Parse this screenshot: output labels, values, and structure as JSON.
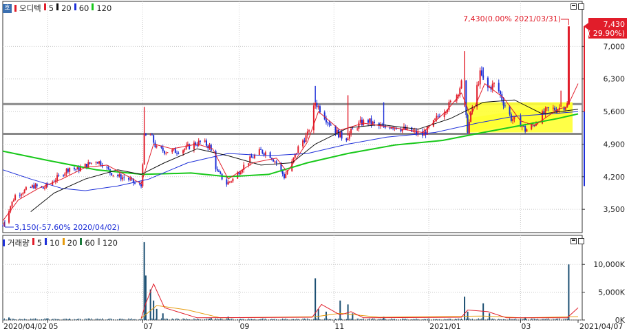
{
  "price_legend": {
    "badge": "호",
    "title": "오디텍",
    "ma": [
      {
        "label": "5",
        "color": "#e11d2a"
      },
      {
        "label": "20",
        "color": "#111111"
      },
      {
        "label": "60",
        "color": "#1d2fd8"
      },
      {
        "label": "120",
        "color": "#18c81a"
      }
    ]
  },
  "volume_legend": {
    "title": "거래량",
    "ma": [
      {
        "label": "5",
        "color": "#e11d2a"
      },
      {
        "label": "10",
        "color": "#1d2fd8"
      },
      {
        "label": "20",
        "color": "#e69b0c"
      },
      {
        "label": "60",
        "color": "#1a7a3a"
      },
      {
        "label": "120",
        "color": "#999999"
      }
    ]
  },
  "annotations": {
    "high": "7,430(0.00% 2021/03/31)",
    "low": "3,150(-57.60% 2020/04/02)",
    "last_price": "7,430",
    "last_change": "( 29.90%)"
  },
  "colors": {
    "up": "#e11d2a",
    "down": "#1d2fd8",
    "ma5": "#e11d2a",
    "ma20": "#111111",
    "ma60": "#1d2fd8",
    "ma120": "#18c81a",
    "volume_bar": "#1b4f72",
    "hline": "#888888",
    "box": "#ffff33",
    "grid": "#c8c8c8"
  },
  "chart_data": [
    {
      "type": "candlestick",
      "title": "오디텍",
      "ylim": [
        3000,
        7700
      ],
      "yticks": [
        3500,
        4200,
        4900,
        5600,
        6300,
        7000
      ],
      "ytick_labels": [
        "3,500",
        "4,200",
        "4,900",
        "5,600",
        "6,300",
        "7,000"
      ],
      "x_labels": [
        "2020/04/02",
        "05",
        "07",
        "09",
        "11",
        "2021/01",
        "03",
        "2021/04/07"
      ],
      "horizontal_lines": [
        5760,
        5120
      ],
      "highlight_box": {
        "from": "2021/01/25",
        "to": "2021/04/07",
        "y_from": 5150,
        "y_to": 5800
      },
      "price_path": [
        [
          "2020/04/02",
          3150
        ],
        [
          "2020/04/06",
          3500
        ],
        [
          "2020/04/10",
          3800
        ],
        [
          "2020/04/16",
          3900
        ],
        [
          "2020/04/22",
          4000
        ],
        [
          "2020/04/28",
          3950
        ],
        [
          "2020/05/04",
          4100
        ],
        [
          "2020/05/10",
          4250
        ],
        [
          "2020/05/15",
          4400
        ],
        [
          "2020/05/20",
          4350
        ],
        [
          "2020/05/26",
          4450
        ],
        [
          "2020/06/01",
          4550
        ],
        [
          "2020/06/05",
          4480
        ],
        [
          "2020/06/10",
          4300
        ],
        [
          "2020/06/16",
          4200
        ],
        [
          "2020/06/22",
          4150
        ],
        [
          "2020/06/26",
          4050
        ],
        [
          "2020/06/30",
          4000
        ],
        [
          "2020/07/02",
          5050
        ],
        [
          "2020/07/06",
          5100
        ],
        [
          "2020/07/10",
          4800
        ],
        [
          "2020/07/16",
          4750
        ],
        [
          "2020/07/22",
          4750
        ],
        [
          "2020/07/28",
          4800
        ],
        [
          "2020/08/03",
          4900
        ],
        [
          "2020/08/08",
          4950
        ],
        [
          "2020/08/13",
          4850
        ],
        [
          "2020/08/18",
          4300
        ],
        [
          "2020/08/24",
          4050
        ],
        [
          "2020/08/28",
          4150
        ],
        [
          "2020/09/03",
          4400
        ],
        [
          "2020/09/09",
          4600
        ],
        [
          "2020/09/15",
          4750
        ],
        [
          "2020/09/20",
          4700
        ],
        [
          "2020/09/25",
          4500
        ],
        [
          "2020/09/30",
          4200
        ],
        [
          "2020/10/05",
          4500
        ],
        [
          "2020/10/10",
          4900
        ],
        [
          "2020/10/15",
          5100
        ],
        [
          "2020/10/20",
          5800
        ],
        [
          "2020/10/24",
          5600
        ],
        [
          "2020/10/28",
          5400
        ],
        [
          "2020/11/03",
          5150
        ],
        [
          "2020/11/08",
          5000
        ],
        [
          "2020/11/13",
          5200
        ],
        [
          "2020/11/18",
          5350
        ],
        [
          "2020/11/23",
          5400
        ],
        [
          "2020/11/28",
          5300
        ],
        [
          "2020/12/03",
          5250
        ],
        [
          "2020/12/08",
          5300
        ],
        [
          "2020/12/13",
          5250
        ],
        [
          "2020/12/18",
          5200
        ],
        [
          "2020/12/23",
          5150
        ],
        [
          "2020/12/28",
          5100
        ],
        [
          "2021/01/03",
          5300
        ],
        [
          "2021/01/08",
          5550
        ],
        [
          "2021/01/13",
          5700
        ],
        [
          "2021/01/18",
          5900
        ],
        [
          "2021/01/22",
          6200
        ],
        [
          "2021/01/26",
          5200
        ],
        [
          "2021/01/29",
          5700
        ],
        [
          "2021/02/03",
          6400
        ],
        [
          "2021/02/08",
          6100
        ],
        [
          "2021/02/13",
          6200
        ],
        [
          "2021/02/18",
          5800
        ],
        [
          "2021/02/23",
          5450
        ],
        [
          "2021/02/28",
          5400
        ],
        [
          "2021/03/04",
          5200
        ],
        [
          "2021/03/09",
          5300
        ],
        [
          "2021/03/14",
          5500
        ],
        [
          "2021/03/19",
          5650
        ],
        [
          "2021/03/24",
          5650
        ],
        [
          "2021/03/31",
          5750
        ],
        [
          "2021/04/01",
          7430
        ],
        [
          "2021/04/07",
          7430
        ]
      ],
      "ma5": [
        [
          "2020/04/02",
          3250
        ],
        [
          "2020/04/12",
          3700
        ],
        [
          "2020/04/25",
          3950
        ],
        [
          "2020/05/10",
          4150
        ],
        [
          "2020/05/25",
          4400
        ],
        [
          "2020/06/08",
          4450
        ],
        [
          "2020/06/22",
          4200
        ],
        [
          "2020/06/30",
          4050
        ],
        [
          "2020/07/08",
          4900
        ],
        [
          "2020/07/20",
          4800
        ],
        [
          "2020/08/05",
          4900
        ],
        [
          "2020/08/15",
          4800
        ],
        [
          "2020/08/25",
          4150
        ],
        [
          "2020/09/10",
          4500
        ],
        [
          "2020/09/25",
          4600
        ],
        [
          "2020/10/02",
          4300
        ],
        [
          "2020/10/15",
          4950
        ],
        [
          "2020/10/22",
          5600
        ],
        [
          "2020/11/05",
          5200
        ],
        [
          "2020/11/20",
          5350
        ],
        [
          "2020/12/10",
          5250
        ],
        [
          "2020/12/28",
          5150
        ],
        [
          "2021/01/12",
          5600
        ],
        [
          "2021/01/22",
          6000
        ],
        [
          "2021/01/28",
          5500
        ],
        [
          "2021/02/06",
          6200
        ],
        [
          "2021/02/18",
          5900
        ],
        [
          "2021/03/01",
          5400
        ],
        [
          "2021/03/10",
          5300
        ],
        [
          "2021/03/25",
          5650
        ],
        [
          "2021/03/31",
          5700
        ],
        [
          "2021/04/07",
          6200
        ]
      ],
      "ma20": [
        [
          "2020/04/20",
          3450
        ],
        [
          "2020/05/05",
          3850
        ],
        [
          "2020/05/25",
          4150
        ],
        [
          "2020/06/15",
          4350
        ],
        [
          "2020/06/30",
          4250
        ],
        [
          "2020/07/15",
          4500
        ],
        [
          "2020/08/05",
          4800
        ],
        [
          "2020/08/25",
          4650
        ],
        [
          "2020/09/15",
          4450
        ],
        [
          "2020/10/05",
          4500
        ],
        [
          "2020/10/20",
          4900
        ],
        [
          "2020/11/10",
          5250
        ],
        [
          "2020/12/01",
          5320
        ],
        [
          "2020/12/25",
          5220
        ],
        [
          "2021/01/15",
          5450
        ],
        [
          "2021/02/05",
          5800
        ],
        [
          "2021/02/25",
          5850
        ],
        [
          "2021/03/15",
          5550
        ],
        [
          "2021/04/07",
          5650
        ]
      ],
      "ma60": [
        [
          "2020/04/02",
          4350
        ],
        [
          "2020/04/20",
          4150
        ],
        [
          "2020/05/10",
          3950
        ],
        [
          "2020/05/25",
          3900
        ],
        [
          "2020/06/15",
          4000
        ],
        [
          "2020/07/05",
          4150
        ],
        [
          "2020/07/30",
          4500
        ],
        [
          "2020/08/25",
          4700
        ],
        [
          "2020/09/20",
          4650
        ],
        [
          "2020/10/15",
          4700
        ],
        [
          "2020/11/10",
          4900
        ],
        [
          "2020/12/05",
          5050
        ],
        [
          "2021/01/05",
          5150
        ],
        [
          "2021/02/01",
          5350
        ],
        [
          "2021/02/25",
          5500
        ],
        [
          "2021/03/20",
          5550
        ],
        [
          "2021/04/07",
          5600
        ]
      ],
      "ma120": [
        [
          "2020/04/02",
          4750
        ],
        [
          "2020/05/01",
          4550
        ],
        [
          "2020/06/01",
          4350
        ],
        [
          "2020/07/01",
          4250
        ],
        [
          "2020/08/01",
          4280
        ],
        [
          "2020/08/25",
          4200
        ],
        [
          "2020/09/20",
          4250
        ],
        [
          "2020/10/15",
          4500
        ],
        [
          "2020/11/10",
          4700
        ],
        [
          "2020/12/10",
          4880
        ],
        [
          "2021/01/10",
          4980
        ],
        [
          "2021/02/05",
          5150
        ],
        [
          "2021/03/01",
          5300
        ],
        [
          "2021/03/25",
          5450
        ],
        [
          "2021/04/07",
          5550
        ]
      ],
      "spikes": [
        [
          "2020/07/02",
          5700
        ],
        [
          "2020/10/20",
          6150
        ],
        [
          "2020/11/10",
          5950
        ],
        [
          "2020/12/03",
          5800
        ],
        [
          "2021/01/24",
          6900
        ],
        [
          "2021/02/05",
          6550
        ],
        [
          "2021/03/27",
          6050
        ]
      ]
    },
    {
      "type": "bar",
      "title": "거래량",
      "ylim": [
        0,
        13000
      ],
      "yticks": [
        0,
        5000,
        10000
      ],
      "ytick_labels": [
        "0K",
        "5,000K",
        "10,000K"
      ],
      "bars": [
        [
          "2020/04/06",
          450
        ],
        [
          "2020/05/01",
          300
        ],
        [
          "2020/05/15",
          200
        ],
        [
          "2020/07/02",
          14000
        ],
        [
          "2020/07/03",
          8000
        ],
        [
          "2020/07/06",
          5500
        ],
        [
          "2020/07/08",
          3500
        ],
        [
          "2020/07/10",
          2000
        ],
        [
          "2020/07/14",
          1200
        ],
        [
          "2020/08/14",
          400
        ],
        [
          "2020/08/25",
          600
        ],
        [
          "2020/10/20",
          7500
        ],
        [
          "2020/10/22",
          2000
        ],
        [
          "2020/10/27",
          1500
        ],
        [
          "2020/11/05",
          3500
        ],
        [
          "2020/11/10",
          2800
        ],
        [
          "2020/11/13",
          1200
        ],
        [
          "2020/12/03",
          600
        ],
        [
          "2021/01/24",
          4200
        ],
        [
          "2021/01/26",
          1500
        ],
        [
          "2021/02/05",
          3000
        ],
        [
          "2021/02/09",
          1200
        ],
        [
          "2021/03/04",
          500
        ],
        [
          "2021/04/01",
          10000
        ]
      ],
      "ma5": [
        [
          "2020/06/30",
          300
        ],
        [
          "2020/07/03",
          3000
        ],
        [
          "2020/07/08",
          6500
        ],
        [
          "2020/07/15",
          2200
        ],
        [
          "2020/08/05",
          400
        ],
        [
          "2020/10/18",
          500
        ],
        [
          "2020/10/24",
          2800
        ],
        [
          "2020/11/05",
          900
        ],
        [
          "2020/11/12",
          1500
        ],
        [
          "2020/11/20",
          400
        ],
        [
          "2021/01/22",
          500
        ],
        [
          "2021/01/26",
          1800
        ],
        [
          "2021/02/08",
          1500
        ],
        [
          "2021/02/20",
          400
        ],
        [
          "2021/03/31",
          400
        ],
        [
          "2021/04/07",
          2200
        ]
      ],
      "ma20": [
        [
          "2020/06/30",
          300
        ],
        [
          "2020/07/10",
          2600
        ],
        [
          "2020/07/30",
          1800
        ],
        [
          "2020/08/20",
          400
        ],
        [
          "2020/10/20",
          600
        ],
        [
          "2020/11/05",
          1200
        ],
        [
          "2020/11/30",
          500
        ],
        [
          "2021/02/05",
          700
        ],
        [
          "2021/03/01",
          400
        ],
        [
          "2021/04/07",
          600
        ]
      ]
    }
  ]
}
